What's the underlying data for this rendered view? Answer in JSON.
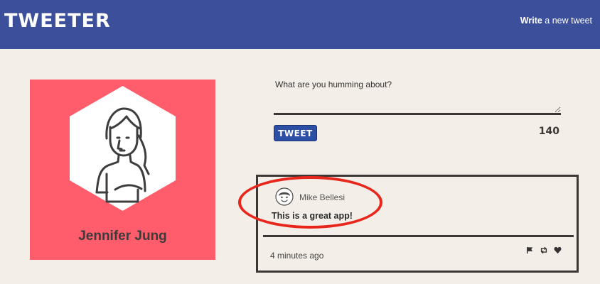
{
  "header": {
    "logo": "TWEETER",
    "compose_link_bold": "Write",
    "compose_link_rest": " a new tweet"
  },
  "profile": {
    "name": "Jennifer Jung",
    "avatar_icon": "woman-avatar-icon",
    "background_color": "#ff5d6c"
  },
  "compose": {
    "placeholder": "What are you humming about?",
    "button_label": "TWEET",
    "char_count": "140"
  },
  "tweet": {
    "author": "Mike Bellesi",
    "text": "This is a great app!",
    "timestamp": "4 minutes ago",
    "avatar_icon": "man-avatar-icon",
    "actions": [
      "flag-icon",
      "retweet-icon",
      "heart-icon"
    ]
  },
  "colors": {
    "header": "#3b4f9b",
    "background": "#f3efe8",
    "highlight": "#e8261c"
  }
}
